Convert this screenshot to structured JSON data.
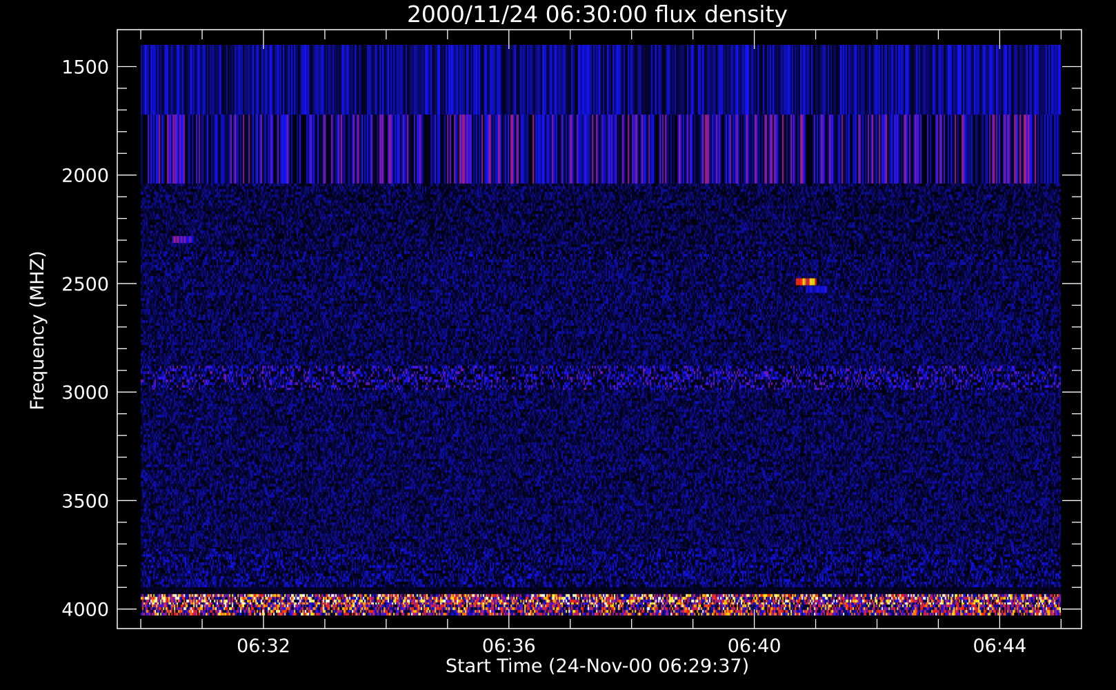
{
  "chart_data": {
    "type": "heatmap",
    "title": "2000/11/24 06:30:00 flux density",
    "xlabel": "Start Time (24-Nov-00 06:29:37)",
    "ylabel": "Frequency (MHZ)",
    "xlim": [
      "06:29:37",
      "06:45:20"
    ],
    "ylim": [
      1330,
      4090
    ],
    "y_inverted": true,
    "data_extent": {
      "x": [
        "06:30:00",
        "06:45:00"
      ],
      "y": [
        1400,
        4030
      ]
    },
    "x_ticks": [
      "06:32",
      "06:36",
      "06:40",
      "06:44"
    ],
    "y_ticks": [
      1500,
      2000,
      2500,
      3000,
      3500,
      4000
    ],
    "colormap": [
      "#000000",
      "#0a0a6e",
      "#1414ff",
      "#b41e78",
      "#ff2000",
      "#ffe600",
      "#ffffff"
    ],
    "bands": [
      {
        "y": [
          1400,
          1720
        ],
        "mean": 0.18,
        "noise": 0.16,
        "vertical_streaks": true
      },
      {
        "y": [
          1720,
          2040
        ],
        "mean": 0.22,
        "noise": 0.28,
        "vertical_streaks": true
      },
      {
        "y": [
          2040,
          2350
        ],
        "mean": 0.1,
        "noise": 0.14
      },
      {
        "y": [
          2350,
          2390
        ],
        "mean": 0.09,
        "noise": 0.2
      },
      {
        "y": [
          2390,
          2880
        ],
        "mean": 0.12,
        "noise": 0.14
      },
      {
        "y": [
          2880,
          2990
        ],
        "mean": 0.14,
        "noise": 0.3
      },
      {
        "y": [
          2990,
          3720
        ],
        "mean": 0.12,
        "noise": 0.14
      },
      {
        "y": [
          3720,
          3900
        ],
        "mean": 0.12,
        "noise": 0.2
      },
      {
        "y": [
          3900,
          3930
        ],
        "mean": 0.05,
        "noise": 0.04
      },
      {
        "y": [
          3930,
          3980
        ],
        "mean": 0.5,
        "noise": 0.5
      },
      {
        "y": [
          3980,
          4030
        ],
        "mean": 0.4,
        "noise": 0.45
      }
    ],
    "hot_spots": [
      {
        "time": "06:40:50",
        "freq": 2495,
        "value": 0.8
      },
      {
        "time": "06:41:00",
        "freq": 2530,
        "value": 0.35
      },
      {
        "time": "06:30:40",
        "freq": 2300,
        "value": 0.5
      }
    ]
  }
}
